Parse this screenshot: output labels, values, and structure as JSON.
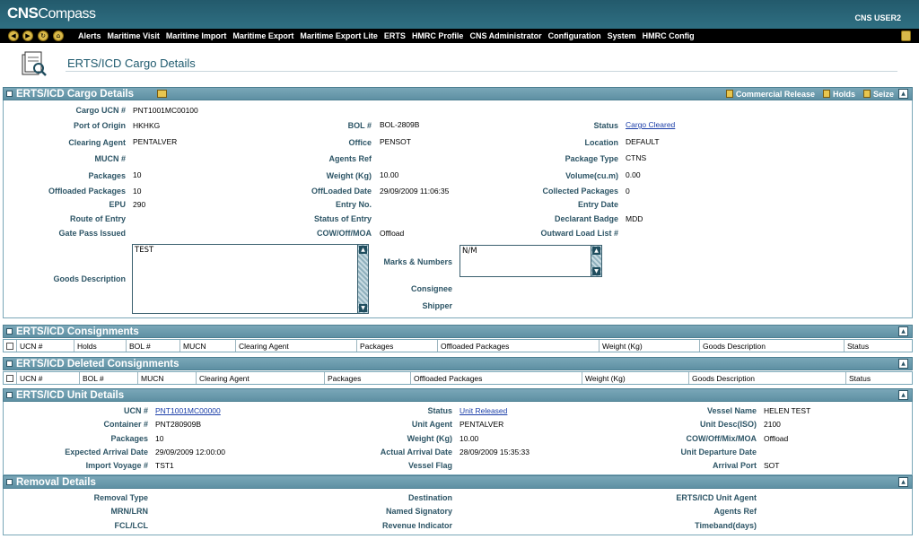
{
  "app": {
    "logo_cns": "CNS",
    "logo_compass": "Compass",
    "user": "CNS USER2"
  },
  "menu": [
    "Alerts",
    "Maritime Visit",
    "Maritime Import",
    "Maritime Export",
    "Maritime Export Lite",
    "ERTS",
    "HMRC Profile",
    "CNS Administrator",
    "Configuration",
    "System",
    "HMRC Config"
  ],
  "page_title": "ERTS/ICD Cargo Details",
  "cargo": {
    "header": "ERTS/ICD Cargo Details",
    "links": {
      "commercial_release": "Commercial Release",
      "holds": "Holds",
      "seize": "Seize"
    },
    "labels": {
      "ucn": "Cargo UCN #",
      "origin": "Port of Origin",
      "clearing": "Clearing Agent",
      "mucn": "MUCN #",
      "packages": "Packages",
      "offloaded_pkgs": "Offloaded Packages",
      "epu": "EPU",
      "route": "Route of Entry",
      "gatepass": "Gate Pass Issued",
      "bol": "BOL #",
      "office": "Office",
      "agents_ref": "Agents Ref",
      "weight": "Weight (Kg)",
      "offloaded_date": "OffLoaded Date",
      "entry_no": "Entry No.",
      "entry_status": "Status of Entry",
      "cow": "COW/Off/MOA",
      "status": "Status",
      "location": "Location",
      "pkg_type": "Package Type",
      "volume": "Volume(cu.m)",
      "collected": "Collected Packages",
      "entry_date": "Entry Date",
      "badge": "Declarant Badge",
      "outward": "Outward Load List #",
      "goods": "Goods Description",
      "marks": "Marks & Numbers",
      "consignee": "Consignee",
      "shipper": "Shipper"
    },
    "values": {
      "ucn": "PNT1001MC00100",
      "origin": "HKHKG",
      "clearing": "PENTALVER",
      "packages": "10",
      "offloaded_pkgs": "10",
      "epu": "290",
      "bol": "BOL-2809B",
      "office": "PENSOT",
      "weight": "10.00",
      "offloaded_date": "29/09/2009 11:06:35",
      "cow": "Offload",
      "status": "Cargo Cleared",
      "location": "DEFAULT",
      "pkg_type": "CTNS",
      "volume": "0.00",
      "collected": "0",
      "badge": "MDD",
      "goods": "TEST",
      "marks": "N/M"
    }
  },
  "consignments": {
    "header": "ERTS/ICD Consignments",
    "columns": [
      "UCN #",
      "Holds",
      "BOL #",
      "MUCN",
      "Clearing Agent",
      "Packages",
      "Offloaded Packages",
      "Weight (Kg)",
      "Goods Description",
      "Status"
    ]
  },
  "deleted": {
    "header": "ERTS/ICD Deleted Consignments",
    "columns": [
      "UCN #",
      "BOL #",
      "MUCN",
      "Clearing Agent",
      "Packages",
      "Offloaded Packages",
      "Weight (Kg)",
      "Goods Description",
      "Status"
    ]
  },
  "unit": {
    "header": "ERTS/ICD Unit Details",
    "labels": {
      "ucn": "UCN #",
      "container": "Container #",
      "packages": "Packages",
      "eta": "Expected Arrival Date",
      "voyage": "Import Voyage #",
      "status": "Status",
      "agent": "Unit Agent",
      "weight": "Weight (Kg)",
      "ata": "Actual Arrival Date",
      "flag": "Vessel Flag",
      "vessel": "Vessel Name",
      "desc": "Unit Desc(ISO)",
      "cow": "COW/Off/Mix/MOA",
      "departure": "Unit Departure Date",
      "port": "Arrival Port"
    },
    "values": {
      "ucn": "PNT1001MC00000",
      "container": "PNT280909B",
      "packages": "10",
      "eta": "29/09/2009 12:00:00",
      "voyage": "TST1",
      "status": "Unit Released",
      "agent": "PENTALVER",
      "weight": "10.00",
      "ata": "28/09/2009 15:35:33",
      "vessel": "HELEN TEST",
      "desc": "2100",
      "cow": "Offload",
      "port": "SOT"
    }
  },
  "removal": {
    "header": "Removal Details",
    "labels": {
      "type": "Removal Type",
      "mrn": "MRN/LRN",
      "fcl": "FCL/LCL",
      "dest": "Destination",
      "signatory": "Named Signatory",
      "revenue": "Revenue Indicator",
      "agent": "ERTS/ICD Unit Agent",
      "ref": "Agents Ref",
      "timeband": "Timeband(days)"
    }
  }
}
